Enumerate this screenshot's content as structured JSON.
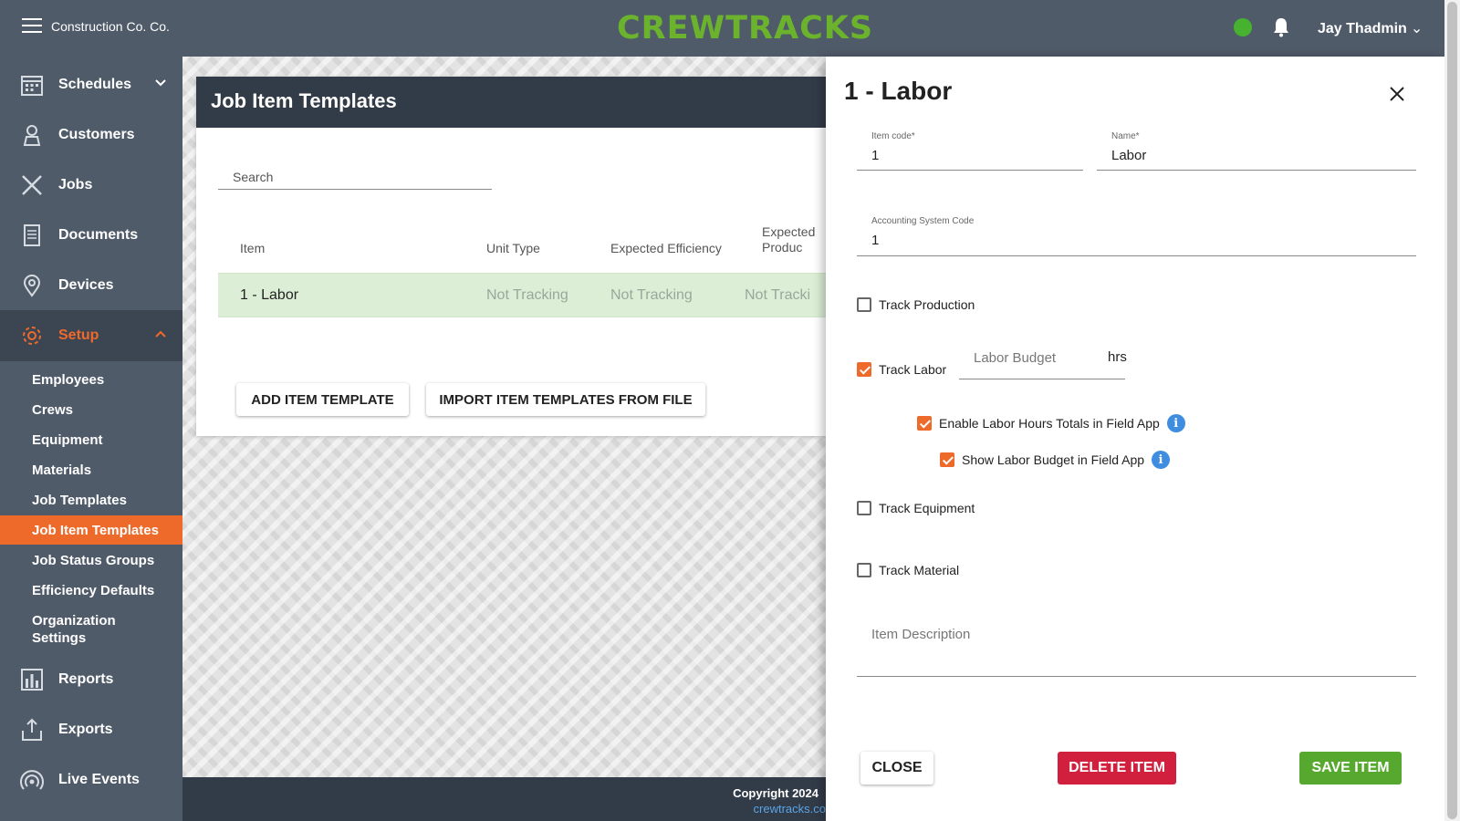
{
  "header": {
    "company": "Construction Co. Co.",
    "logo_text": "CREWTRACKS",
    "status_color": "#46b22f",
    "user_name": "Jay Thadmin"
  },
  "sidebar": {
    "items": [
      {
        "label": "Schedules",
        "icon": "calendar-icon"
      },
      {
        "label": "Customers",
        "icon": "customer-icon"
      },
      {
        "label": "Jobs",
        "icon": "tools-icon"
      },
      {
        "label": "Documents",
        "icon": "document-icon"
      },
      {
        "label": "Devices",
        "icon": "location-pin-icon"
      },
      {
        "label": "Setup",
        "icon": "gear-icon"
      }
    ],
    "setup_items": [
      "Employees",
      "Crews",
      "Equipment",
      "Materials",
      "Job Templates",
      "Job Item Templates",
      "Job Status Groups",
      "Efficiency Defaults",
      "Organization Settings"
    ],
    "bottom_items": [
      {
        "label": "Reports",
        "icon": "bar-chart-icon"
      },
      {
        "label": "Exports",
        "icon": "export-icon"
      },
      {
        "label": "Live Events",
        "icon": "broadcast-icon"
      }
    ]
  },
  "page": {
    "title": "Job Item Templates",
    "search_placeholder": "Search",
    "columns": [
      "Item",
      "Unit Type",
      "Expected Efficiency",
      "Expected Produc"
    ],
    "rows": [
      {
        "item": "1 - Labor",
        "unit_type": "Not Tracking",
        "expected_efficiency": "Not Tracking",
        "expected_production": "Not Tracki"
      }
    ],
    "add_button": "ADD ITEM TEMPLATE",
    "import_button": "IMPORT ITEM TEMPLATES FROM FILE"
  },
  "footer": {
    "copyright": "Copyright 2024",
    "link": "crewtracks.co"
  },
  "drawer": {
    "title": "1 - Labor",
    "item_code_label": "Item code*",
    "item_code_value": "1",
    "name_label": "Name*",
    "name_value": "Labor",
    "accounting_label": "Accounting System Code",
    "accounting_value": "1",
    "track_production": {
      "label": "Track Production",
      "checked": false
    },
    "track_labor": {
      "label": "Track Labor",
      "checked": true
    },
    "labor_budget_placeholder": "Labor Budget",
    "labor_budget_unit": "hrs",
    "enable_labor_totals": {
      "label": "Enable Labor Hours Totals in Field App",
      "checked": true
    },
    "show_labor_budget": {
      "label": "Show Labor Budget in Field App",
      "checked": true
    },
    "track_equipment": {
      "label": "Track Equipment",
      "checked": false
    },
    "track_material": {
      "label": "Track Material",
      "checked": false
    },
    "description_placeholder": "Item Description",
    "close_button": "CLOSE",
    "delete_button": "DELETE ITEM",
    "save_button": "SAVE ITEM"
  },
  "colors": {
    "accent_orange": "#ed6a2b",
    "sidebar": "#505b6a",
    "delete_red": "#d0203d",
    "save_green": "#57a82f",
    "row_highlight": "#dcefd6"
  }
}
